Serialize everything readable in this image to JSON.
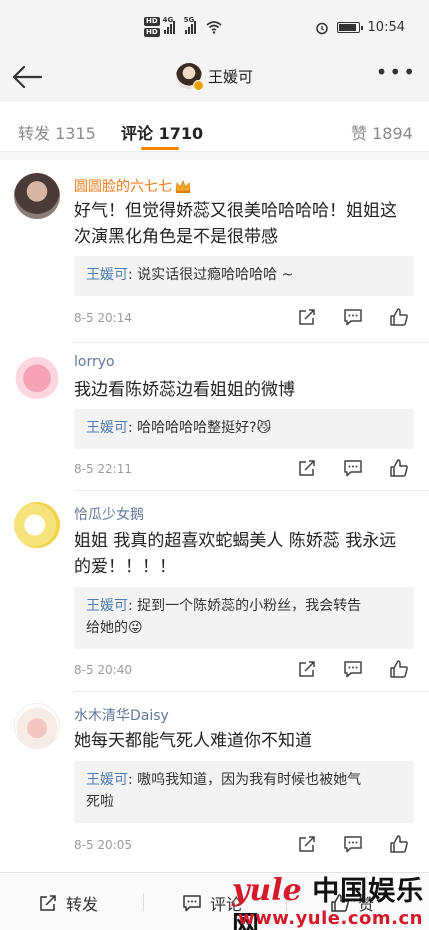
{
  "status_bar": {
    "hd1": "HD",
    "hd2": "HD",
    "net1": "4G",
    "net2": "5G",
    "time": "10:54",
    "battery_level": 0.9
  },
  "header": {
    "username": "王媛可"
  },
  "tabs": [
    {
      "label": "转发",
      "count": "1315"
    },
    {
      "label": "评论",
      "count": "1710"
    },
    {
      "label": "赞",
      "count": "1894"
    }
  ],
  "comments": [
    {
      "name": "圆圆脸的六七七",
      "text_line1": "好气！但觉得娇蕊又很美哈哈哈哈！姐姐这",
      "text_line2": "次演黑化角色是不是很带感",
      "reply_name": "王媛可",
      "reply_text": ": 说实话很过瘾哈哈哈哈 ~",
      "time": "8-5 20:14"
    },
    {
      "name": "lorryo",
      "text_line1": "我边看陈娇蕊边看姐姐的微博",
      "reply_name": "王媛可",
      "reply_text": ": 哈哈哈哈哈整挺好?",
      "reply_emoji": "😼",
      "time": "8-5 22:11"
    },
    {
      "name": "恰瓜少女鹅",
      "text_line1": "姐姐 我真的超喜欢蛇蝎美人 陈娇蕊 我永远",
      "text_line2": "的爱！！！！",
      "reply_name": "王媛可",
      "reply_text_line1": ": 捉到一个陈娇蕊的小粉丝，我会转告",
      "reply_text_line2": "给她的",
      "reply_emoji": "😜",
      "time": "8-5 20:40"
    },
    {
      "name": "水木清华Daisy",
      "text_line1": "她每天都能气死人难道你不知道",
      "reply_name": "王媛可",
      "reply_text_line1": ": 嗷呜我知道，因为我有时候也被她气",
      "reply_text_line2": "死啦",
      "time": "8-5 20:05"
    }
  ],
  "bottom_bar": {
    "repost_label": "转发",
    "comment_label": "评论",
    "like_label": "赞"
  },
  "watermark": {
    "brand": "yule",
    "cn": "中国娱乐网",
    "url": "www.yule.com.cn"
  },
  "colors": {
    "accent": "#ff8200",
    "name_link": "#63789a",
    "vip_name": "#f17a1b",
    "reply_name": "#507daf",
    "watermark_red": "#d4192a"
  }
}
